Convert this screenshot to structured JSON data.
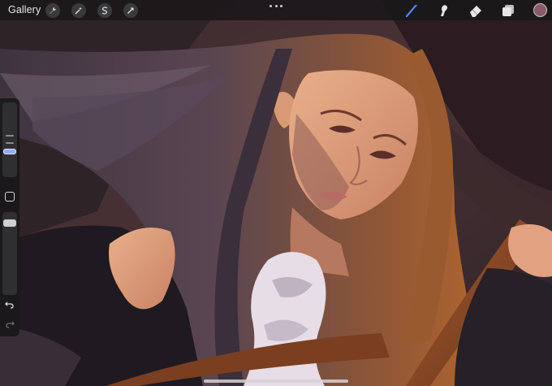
{
  "toolbar": {
    "gallery_label": "Gallery",
    "left_icons": [
      "wrench-icon",
      "magic-wand-icon",
      "selection-icon",
      "transform-arrow-icon"
    ],
    "right_icons": [
      "brush-icon",
      "smudge-icon",
      "eraser-icon",
      "layers-icon"
    ],
    "active_tool": "brush",
    "active_color": "#8a5a66"
  },
  "sidebar": {
    "brush_size_level": 0.3,
    "opacity_level": 0.1,
    "icons": [
      "modify-square-icon",
      "undo-icon",
      "redo-icon"
    ]
  },
  "colors": {
    "accent": "#4d86ff",
    "toolbar_bg": "#1a181a"
  },
  "canvas": {
    "subject": "illustration"
  }
}
